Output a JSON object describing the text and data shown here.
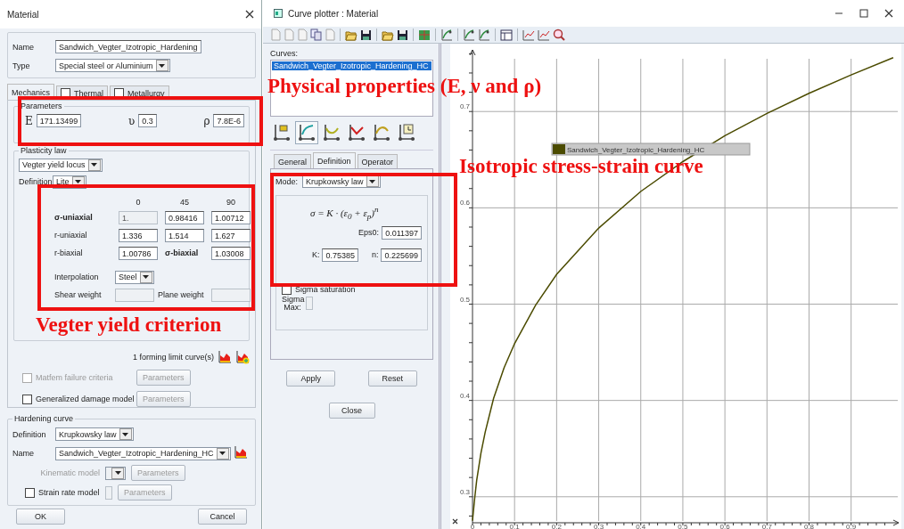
{
  "material_dialog": {
    "title": "Material",
    "name_label": "Name",
    "name_value": "Sandwich_Vegter_Izotropic_Hardening",
    "type_label": "Type",
    "type_value": "Special steel or Aluminium",
    "tabs": [
      {
        "label": "Mechanics",
        "selected": true,
        "kind": "plain"
      },
      {
        "label": "Thermal",
        "selected": false,
        "kind": "checkbox",
        "checked": false
      },
      {
        "label": "Metallurgy",
        "selected": false,
        "kind": "checkbox",
        "checked": false
      }
    ],
    "parameters": {
      "title": "Parameters",
      "fields": [
        {
          "symbol": "E",
          "value": "171.13499"
        },
        {
          "symbol": "ʋ",
          "value": "0.3"
        },
        {
          "symbol": "ρ",
          "value": "7.8E-6"
        }
      ]
    },
    "plasticity": {
      "title": "Plasticity law",
      "law": "Vegter yield locus",
      "definition_label": "Definition",
      "definition_value": "Lite",
      "columns": [
        "0",
        "45",
        "90"
      ],
      "rows": [
        {
          "label": "σ-uniaxial",
          "cells": [
            {
              "kind": "field",
              "value": "1.",
              "disabled": true
            },
            {
              "kind": "field",
              "value": "0.98416",
              "disabled": false
            },
            {
              "kind": "field",
              "value": "1.00712",
              "disabled": false
            }
          ]
        },
        {
          "label": "r-uniaxial",
          "cells": [
            {
              "kind": "field",
              "value": "1.336",
              "disabled": false
            },
            {
              "kind": "field",
              "value": "1.514",
              "disabled": false
            },
            {
              "kind": "field",
              "value": "1.627",
              "disabled": false
            }
          ]
        },
        {
          "label": "r-biaxial",
          "cells": [
            {
              "kind": "field",
              "value": "1.00786",
              "disabled": false
            },
            {
              "kind": "label",
              "value": "σ-biaxial"
            },
            {
              "kind": "field",
              "value": "1.03008",
              "disabled": false
            }
          ]
        }
      ],
      "interpolation_label": "Interpolation",
      "interpolation_value": "Steel",
      "shear_weight_label": "Shear weight",
      "plane_weight_label": "Plane weight"
    },
    "flc_text": "1 forming limit curve(s)",
    "options": [
      {
        "label": "Matfem failure criteria",
        "checked": false,
        "disabled": true,
        "button": "Parameters"
      },
      {
        "label": "Generalized damage model",
        "checked": false,
        "disabled": false,
        "button": "Parameters"
      }
    ],
    "hardening": {
      "title": "Hardening curve",
      "definition_label": "Definition",
      "definition_value": "Krupkowsky law",
      "name_label": "Name",
      "name_value": "Sandwich_Vegter_Izotropic_Hardening_HC",
      "kinematic": {
        "label": "Kinematic model",
        "button": "Parameters",
        "disabled": true
      },
      "strain_rate": {
        "label": "Strain rate model",
        "button": "Parameters",
        "checked": false
      }
    },
    "buttons": [
      "OK",
      "Cancel"
    ]
  },
  "curve_plotter": {
    "title": "Curve plotter : Material",
    "curves_label": "Curves:",
    "curves": [
      {
        "name": "Sandwich_Vegter_Izotropic_Hardening_HC",
        "selected": true
      }
    ],
    "tabs": [
      {
        "label": "General",
        "selected": false
      },
      {
        "label": "Definition",
        "selected": true
      },
      {
        "label": "Operator",
        "selected": false
      }
    ],
    "mode_label": "Mode:",
    "mode_value": "Krupkowsky law",
    "formula": "σ = K · (ε$_{0}$ + ε$_{p}$)$^{n}$",
    "eps0_label": "Eps0:",
    "eps0_value": "0.011397",
    "k_label": "K:",
    "k_value": "0.75385",
    "n_label": "n:",
    "n_value": "0.225699",
    "sigma_saturation": {
      "label": "Sigma saturation",
      "checked": false
    },
    "sigma_max_label": "Sigma Max:",
    "buttons": [
      "Apply",
      "Reset"
    ],
    "close": "Close",
    "chart_data": {
      "type": "line",
      "x": [
        0,
        0.005,
        0.01,
        0.02,
        0.03,
        0.05,
        0.075,
        0.1,
        0.15,
        0.2,
        0.3,
        0.4,
        0.5,
        0.6,
        0.7,
        0.8,
        0.9,
        1.0
      ],
      "series": [
        {
          "name": "Sandwich_Vegter_Izotropic_Hardening_HC",
          "color": "#4b4b00",
          "values": [
            0.275,
            0.298,
            0.317,
            0.345,
            0.367,
            0.402,
            0.434,
            0.459,
            0.499,
            0.531,
            0.579,
            0.617,
            0.648,
            0.675,
            0.698,
            0.719,
            0.738,
            0.756
          ]
        }
      ],
      "xlim": [
        0,
        1.013
      ],
      "ylim": [
        0.273,
        0.764
      ],
      "grid": true,
      "xticks": [
        0,
        0.1,
        0.2,
        0.3,
        0.4,
        0.5,
        0.6,
        0.7,
        0.8,
        0.9
      ],
      "yticks": [
        0.3,
        0.4,
        0.5,
        0.6,
        0.7
      ]
    }
  },
  "annotations": [
    {
      "text": "Physical properties (E, ν and ρ)"
    },
    {
      "text": "Vegter yield criterion"
    },
    {
      "text": "Isotropic stress-strain curve"
    }
  ]
}
